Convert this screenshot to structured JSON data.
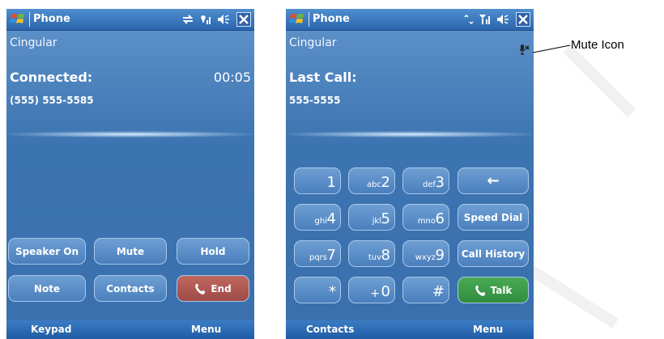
{
  "left_phone": {
    "title": "Phone",
    "carrier": "Cingular",
    "status_label": "Connected:",
    "timer": "00:05",
    "number": "(555) 555-5585",
    "buttons": {
      "speaker": "Speaker On",
      "mute": "Mute",
      "hold": "Hold",
      "note": "Note",
      "contacts": "Contacts",
      "end": "End"
    },
    "softkeys": {
      "left": "Keypad",
      "right": "Menu"
    }
  },
  "right_phone": {
    "title": "Phone",
    "carrier": "Cingular",
    "status_label": "Last Call:",
    "number": "555-5555",
    "keypad": [
      {
        "main": "1",
        "sub": ""
      },
      {
        "main": "2",
        "sub": "abc"
      },
      {
        "main": "3",
        "sub": "def"
      },
      {
        "main": "4",
        "sub": "ghi"
      },
      {
        "main": "5",
        "sub": "jkl"
      },
      {
        "main": "6",
        "sub": "mno"
      },
      {
        "main": "7",
        "sub": "pqrs"
      },
      {
        "main": "8",
        "sub": "tuv"
      },
      {
        "main": "9",
        "sub": "wxyz"
      },
      {
        "main": "*",
        "sub": ""
      },
      {
        "main": "0",
        "sub": "+"
      },
      {
        "main": "#",
        "sub": ""
      }
    ],
    "side_buttons": {
      "backspace": "←",
      "speed_dial": "Speed Dial",
      "call_history": "Call History",
      "talk": "Talk"
    },
    "softkeys": {
      "left": "Contacts",
      "right": "Menu"
    }
  },
  "annotation": {
    "mute_icon_label": "Mute Icon"
  },
  "colors": {
    "screen_bg": "#3f78b4",
    "end_button": "#b05a52",
    "talk_button": "#3c9c48",
    "title_bar": "#2a64ad"
  }
}
